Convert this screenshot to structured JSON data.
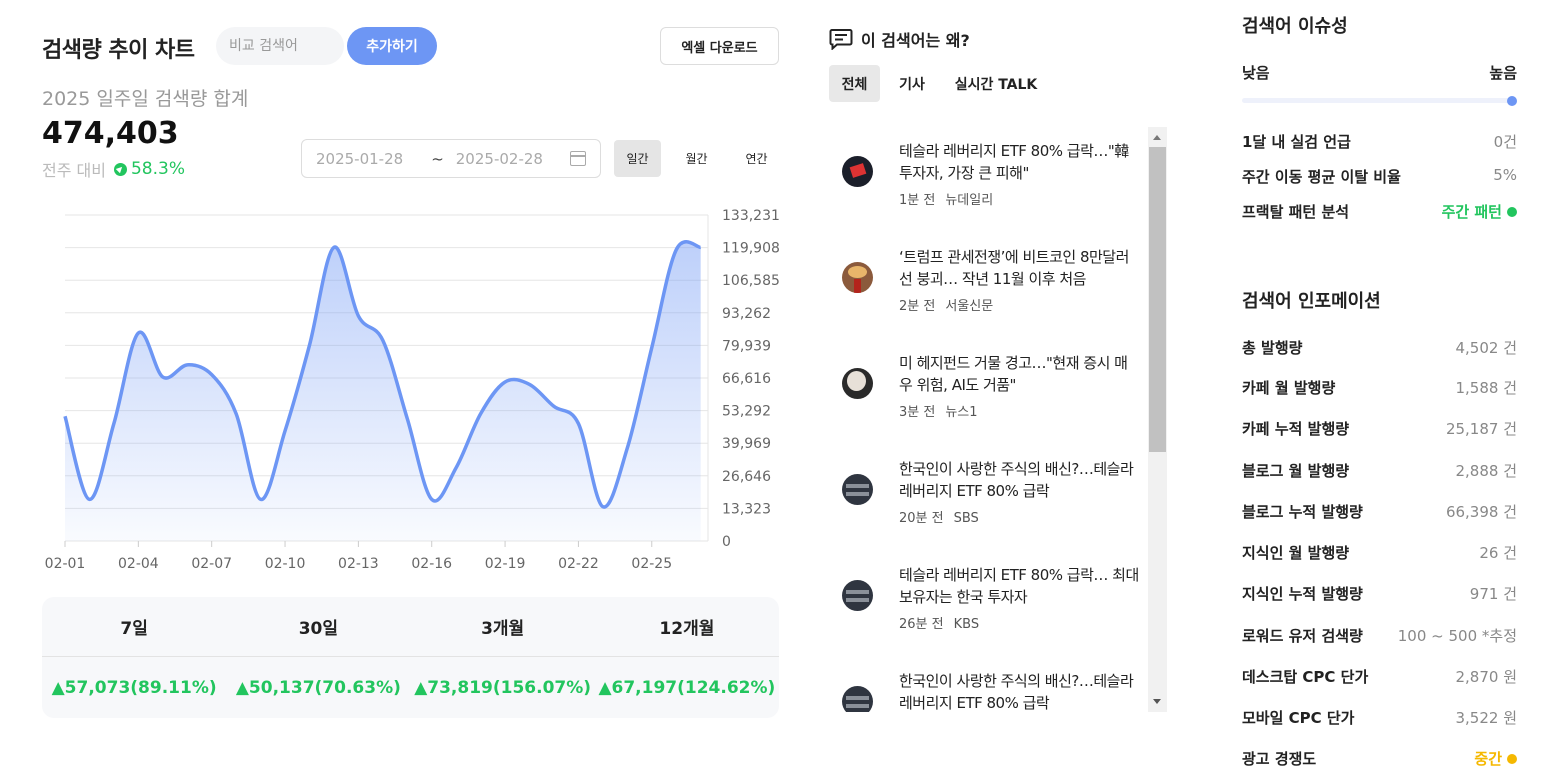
{
  "header": {
    "title": "검색량 추이 차트",
    "compare_placeholder": "비교 검색어",
    "add_label": "추가하기",
    "excel_label": "엑셀 다운로드"
  },
  "summary_stats": {
    "subtitle": "2025 일주일 검색량 합계",
    "total": "474,403",
    "wow_label": "전주 대비",
    "wow_pct": "58.3%"
  },
  "date_range": {
    "start": "2025-01-28",
    "sep": "~",
    "end": "2025-02-28"
  },
  "period_tabs": [
    {
      "label": "일간",
      "active": true
    },
    {
      "label": "월간",
      "active": false
    },
    {
      "label": "연간",
      "active": false
    }
  ],
  "chart_data": {
    "type": "area",
    "x_tick_labels": [
      "02-01",
      "02-04",
      "02-07",
      "02-10",
      "02-13",
      "02-16",
      "02-19",
      "02-22",
      "02-25"
    ],
    "x": [
      "02-01",
      "02-02",
      "02-03",
      "02-04",
      "02-05",
      "02-06",
      "02-07",
      "02-08",
      "02-09",
      "02-10",
      "02-11",
      "02-12",
      "02-13",
      "02-14",
      "02-15",
      "02-16",
      "02-17",
      "02-18",
      "02-19",
      "02-20",
      "02-21",
      "02-22",
      "02-23",
      "02-24",
      "02-25",
      "02-26",
      "02-27"
    ],
    "series": [
      {
        "values": [
          51000,
          17000,
          48000,
          85000,
          67000,
          72000,
          68000,
          52000,
          17000,
          45000,
          80000,
          120000,
          92000,
          82000,
          50000,
          17000,
          30000,
          52000,
          65000,
          64000,
          55000,
          48000,
          14000,
          38000,
          79000,
          119000,
          120000
        ]
      }
    ],
    "y_tick_labels": [
      "0",
      "13,323",
      "26,646",
      "39,969",
      "53,292",
      "66,616",
      "79,939",
      "93,262",
      "106,585",
      "119,908",
      "133,231"
    ],
    "ylim": [
      0,
      133231
    ],
    "grid": true,
    "line_color": "#6d96f4"
  },
  "change_table": {
    "headers": [
      "7일",
      "30일",
      "3개월",
      "12개월"
    ],
    "values": [
      "▲57,073(89.11%)",
      "▲50,137(70.63%)",
      "▲73,819(156.07%)",
      "▲67,197(124.62%)"
    ]
  },
  "why": {
    "title": "이 검색어는 왜?",
    "tabs": [
      {
        "label": "전체",
        "active": true
      },
      {
        "label": "기사",
        "active": false
      },
      {
        "label": "실시간 TALK",
        "active": false
      }
    ],
    "news": [
      {
        "title": "테슬라 레버리지 ETF 80% 급락…\"韓 투자자, 가장 큰 피해\"",
        "time": "1분 전",
        "source": "뉴데일리"
      },
      {
        "title": "‘트럼프 관세전쟁’에 비트코인 8만달러선 붕괴… 작년 11월 이후 처음",
        "time": "2분 전",
        "source": "서울신문"
      },
      {
        "title": "미 헤지펀드 거물 경고…\"현재 증시 매우 위험, AI도 거품\"",
        "time": "3분 전",
        "source": "뉴스1"
      },
      {
        "title": "한국인이 사랑한 주식의 배신?…테슬라 레버리지 ETF 80% 급락",
        "time": "20분 전",
        "source": "SBS"
      },
      {
        "title": "테슬라 레버리지 ETF 80% 급락… 최대 보유자는 한국 투자자",
        "time": "26분 전",
        "source": "KBS"
      },
      {
        "title": "한국인이 사랑한 주식의 배신?…테슬라 레버리지 ETF 80% 급락",
        "time": "",
        "source": ""
      }
    ]
  },
  "issue": {
    "title": "검색어 이슈성",
    "low": "낮음",
    "high": "높음",
    "level": 1.0,
    "rows": [
      {
        "label": "1달 내 실검 언급",
        "value": "0건"
      },
      {
        "label": "주간 이동 평균 이탈 비율",
        "value": "5%"
      },
      {
        "label": "프랙탈 패턴 분석",
        "value": "주간 패턴"
      }
    ]
  },
  "info": {
    "title": "검색어 인포메이션",
    "rows": [
      {
        "label": "총 발행량",
        "value": "4,502 건"
      },
      {
        "label": "카페 월 발행량",
        "value": "1,588 건"
      },
      {
        "label": "카페 누적 발행량",
        "value": "25,187 건"
      },
      {
        "label": "블로그 월 발행량",
        "value": "2,888 건"
      },
      {
        "label": "블로그 누적 발행량",
        "value": "66,398 건"
      },
      {
        "label": "지식인 월 발행량",
        "value": "26 건"
      },
      {
        "label": "지식인 누적 발행량",
        "value": "971 건"
      },
      {
        "label": "로워드 유저 검색량",
        "value": "100 ~ 500 *추정"
      },
      {
        "label": "데스크탑 CPC 단가",
        "value": "2,870 원"
      },
      {
        "label": "모바일 CPC 단가",
        "value": "3,522 원"
      },
      {
        "label": "광고 경쟁도",
        "value": "중간"
      }
    ]
  },
  "colors": {
    "accent": "#6d96f4",
    "up_green": "#22c55e",
    "amber": "#f5b800"
  }
}
